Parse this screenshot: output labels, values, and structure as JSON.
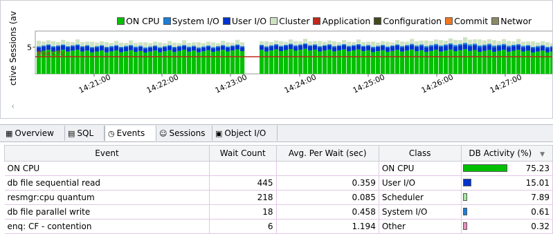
{
  "chart": {
    "y_axis_label": "ctive Sessions (av",
    "y_ticks": [
      "5"
    ],
    "time_labels": [
      "14:21:00",
      "14:22:00",
      "14:23:00",
      "14:24:00",
      "14:25:00",
      "14:26:00",
      "14:27:00"
    ],
    "reference_line_label": "Max CPU",
    "legend": [
      {
        "name": "ON CPU",
        "color": "#00c000"
      },
      {
        "name": "System I/O",
        "color": "#1c7ed6"
      },
      {
        "name": "User I/O",
        "color": "#0033cc"
      },
      {
        "name": "Cluster",
        "color": "#cfe3c4"
      },
      {
        "name": "Application",
        "color": "#c0281e"
      },
      {
        "name": "Configuration",
        "color": "#424a22"
      },
      {
        "name": "Commit",
        "color": "#f07820"
      },
      {
        "name": "Networ",
        "color": "#8a8a66"
      }
    ]
  },
  "chart_data": {
    "type": "area",
    "title": "",
    "ylabel": "ctive Sessions (av",
    "x": [
      "14:21:00",
      "14:22:00",
      "14:23:00",
      "14:24:00",
      "14:25:00",
      "14:26:00",
      "14:27:00"
    ],
    "series": [
      {
        "name": "ON CPU",
        "values": [
          4.4,
          4.2,
          4.3,
          4.5,
          4.3,
          4.4,
          4.2
        ]
      },
      {
        "name": "User I/O",
        "values": [
          0.8,
          0.8,
          0.7,
          0.8,
          0.8,
          0.9,
          0.8
        ]
      },
      {
        "name": "System I/O",
        "values": [
          0.2,
          0.2,
          0.2,
          0.2,
          0.2,
          0.3,
          0.2
        ]
      },
      {
        "name": "Cluster",
        "values": [
          0.6,
          0.5,
          0.5,
          0.5,
          0.5,
          0.7,
          0.5
        ]
      }
    ],
    "reference_line": {
      "label": "Max CPU",
      "value": 3.2
    }
  },
  "tabs": [
    {
      "label": "Overview",
      "icon": "grid-icon"
    },
    {
      "label": "SQL",
      "icon": "sql-icon"
    },
    {
      "label": "Events",
      "icon": "events-icon"
    },
    {
      "label": "Sessions",
      "icon": "sessions-icon"
    },
    {
      "label": "Object I/O",
      "icon": "object-io-icon"
    }
  ],
  "table": {
    "headers": [
      "Event",
      "Wait Count",
      "Avg. Per Wait (sec)",
      "Class",
      "DB Activity (%)"
    ],
    "rows": [
      {
        "event": "ON CPU",
        "wait_count": "",
        "avg": "",
        "class": "ON CPU",
        "activity": "75.23",
        "bar_fraction": 0.7523,
        "color": "#00c000"
      },
      {
        "event": "db file sequential read",
        "wait_count": "445",
        "avg": "0.359",
        "class": "User I/O",
        "activity": "15.01",
        "bar_fraction": 0.1501,
        "color": "#0033cc"
      },
      {
        "event": "resmgr:cpu quantum",
        "wait_count": "218",
        "avg": "0.085",
        "class": "Scheduler",
        "activity": "7.89",
        "bar_fraction": 0.0789,
        "color": "#a8e8a0"
      },
      {
        "event": "db file parallel write",
        "wait_count": "18",
        "avg": "0.458",
        "class": "System I/O",
        "activity": "0.61",
        "bar_fraction": 0.0061,
        "color": "#1c7ed6"
      },
      {
        "event": "enq: CF - contention",
        "wait_count": "6",
        "avg": "1.194",
        "class": "Other",
        "activity": "0.32",
        "bar_fraction": 0.0032,
        "color": "#e890c0"
      }
    ]
  }
}
